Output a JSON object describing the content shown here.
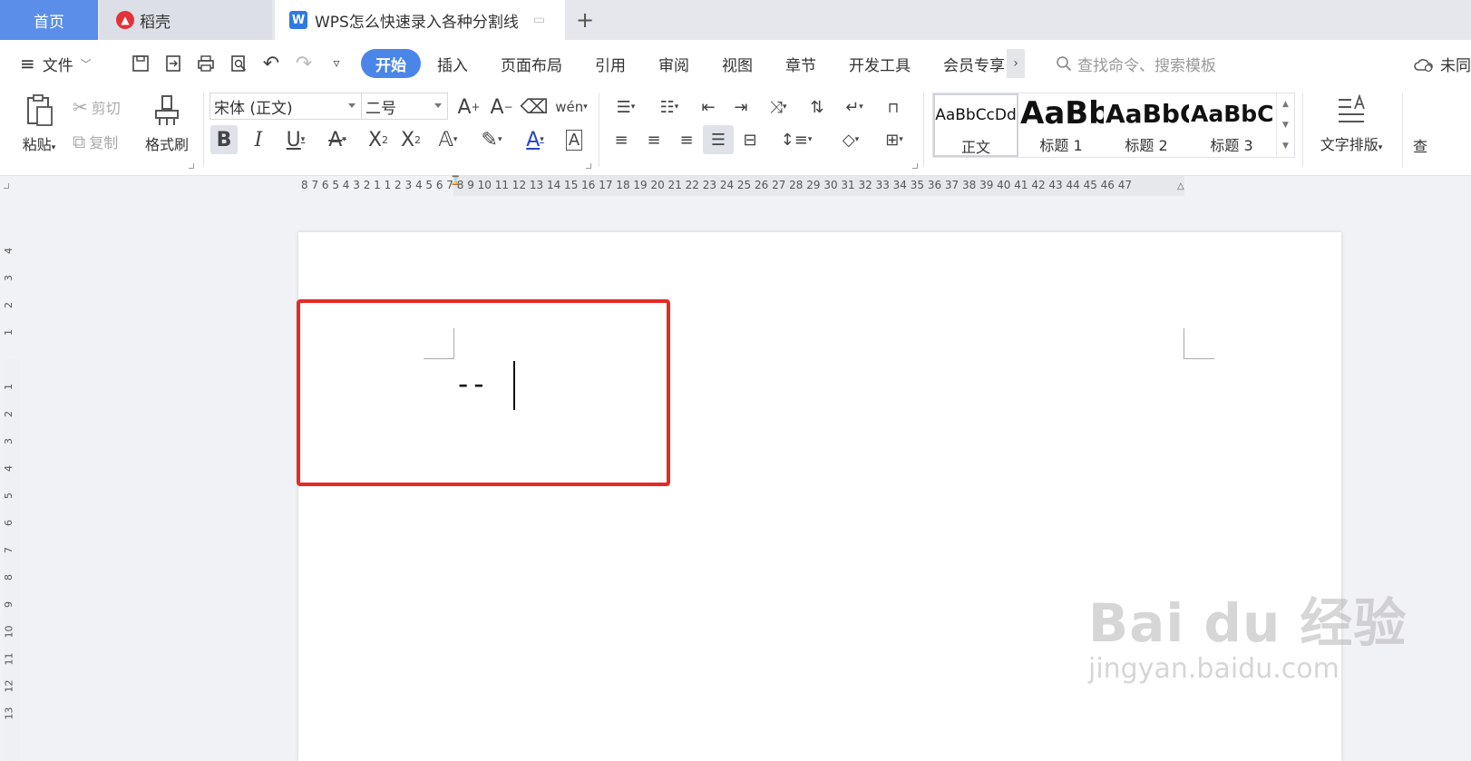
{
  "tabs": {
    "home": "首页",
    "daoke": "稻壳",
    "doc": "WPS怎么快速录入各种分割线",
    "add": "+"
  },
  "menu": {
    "file": "文件",
    "tabs": [
      "开始",
      "插入",
      "页面布局",
      "引用",
      "审阅",
      "视图",
      "章节",
      "开发工具",
      "会员专享"
    ],
    "more": "›",
    "search_placeholder": "查找命令、搜索模板",
    "cloud": "未同步"
  },
  "ribbon": {
    "paste": "粘贴",
    "cut": "剪切",
    "copy": "复制",
    "format_painter": "格式刷",
    "font_name": "宋体 (正文)",
    "font_size": "二号",
    "pinyin": "wén",
    "styles": [
      {
        "sample": "AaBbCcDd",
        "name": "正文"
      },
      {
        "sample": "AaBb",
        "name": "标题 1"
      },
      {
        "sample": "AaBbC",
        "name": "标题 2"
      },
      {
        "sample": "AaBbCc",
        "name": "标题 3"
      }
    ],
    "text_layout": "文字排版",
    "find": "查"
  },
  "ruler": {
    "horizontal": "8  7  6  5  4  3  2  1     1  2  3  4  5  6  7  8  9  10 11 12 13 14 15 16 17 18 19 20 21 22 23 24 25 26 27 28 29 30 31 32 33 34 35 36 37 38 39 40 41 42 43 44 45 46 47",
    "vertical": [
      "4",
      "3",
      "2",
      "1",
      "1",
      "2",
      "3",
      "4",
      "5",
      "6",
      "7",
      "8",
      "9",
      "10",
      "11",
      "12",
      "13"
    ]
  },
  "document": {
    "text": "--"
  },
  "watermark": {
    "main": "Bai du 经验",
    "sub": "jingyan.baidu.com"
  },
  "colors": {
    "accent": "#4a86e8",
    "highlight_border": "#e52a25"
  }
}
